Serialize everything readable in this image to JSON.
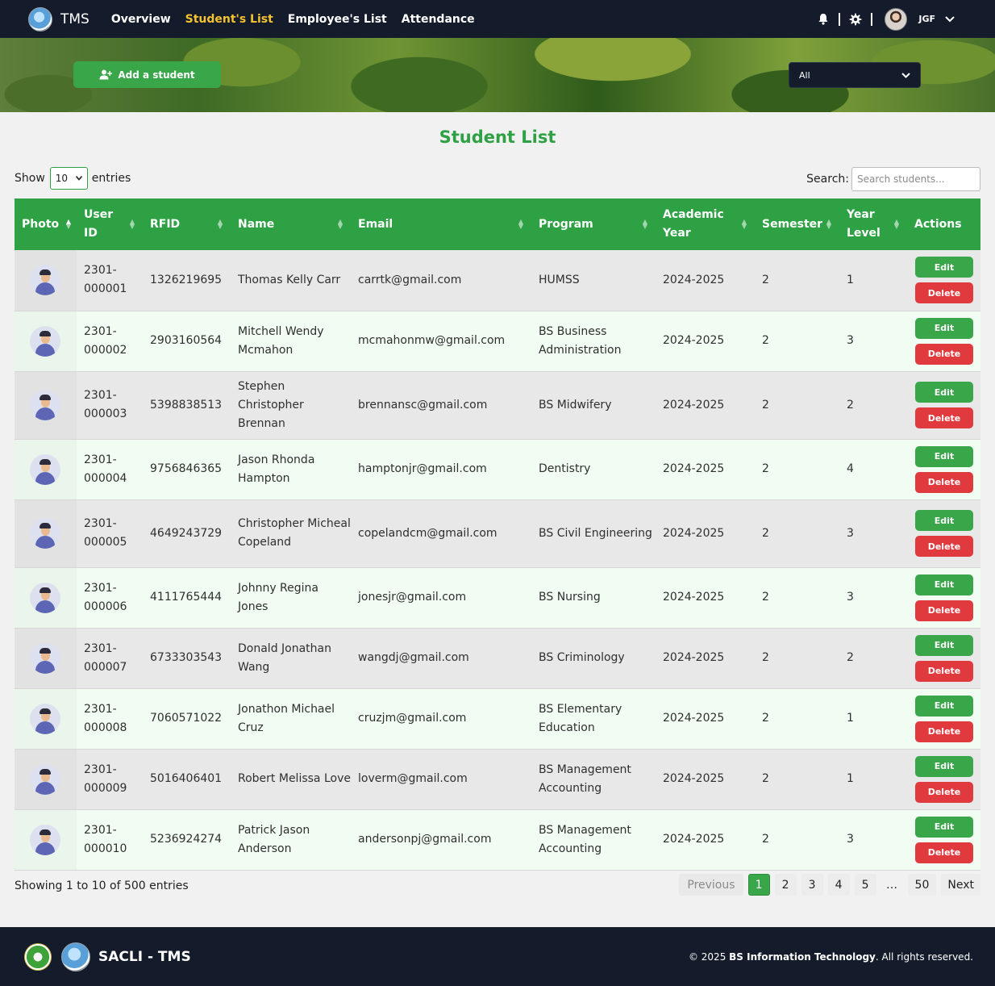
{
  "nav": {
    "brand": "TMS",
    "links": [
      "Overview",
      "Student's List",
      "Employee's List",
      "Attendance"
    ],
    "active_index": 1,
    "user_initials": "JGF"
  },
  "banner": {
    "add_button": "Add a student",
    "filter_value": "All"
  },
  "page_title": "Student List",
  "controls": {
    "show_label": "Show",
    "entries_value": "10",
    "entries_label": "entries",
    "search_label": "Search:",
    "search_placeholder": "Search students..."
  },
  "table": {
    "columns": [
      {
        "label": "Photo"
      },
      {
        "label": "User ID"
      },
      {
        "label": "RFID"
      },
      {
        "label": "Name"
      },
      {
        "label": "Email"
      },
      {
        "label": "Program"
      },
      {
        "label": "Academic Year"
      },
      {
        "label": "Semester"
      },
      {
        "label": "Year Level"
      },
      {
        "label": "Actions"
      }
    ],
    "edit_label": "Edit",
    "delete_label": "Delete",
    "rows": [
      {
        "user_id": "2301-000001",
        "rfid": "1326219695",
        "name": "Thomas Kelly Carr",
        "email": "carrtk@gmail.com",
        "program": "HUMSS",
        "academic_year": "2024-2025",
        "semester": "2",
        "year_level": "1"
      },
      {
        "user_id": "2301-000002",
        "rfid": "2903160564",
        "name": "Mitchell Wendy Mcmahon",
        "email": "mcmahonmw@gmail.com",
        "program": "BS Business Administration",
        "academic_year": "2024-2025",
        "semester": "2",
        "year_level": "3"
      },
      {
        "user_id": "2301-000003",
        "rfid": "5398838513",
        "name": "Stephen Christopher Brennan",
        "email": "brennansc@gmail.com",
        "program": "BS Midwifery",
        "academic_year": "2024-2025",
        "semester": "2",
        "year_level": "2"
      },
      {
        "user_id": "2301-000004",
        "rfid": "9756846365",
        "name": "Jason Rhonda Hampton",
        "email": "hamptonjr@gmail.com",
        "program": "Dentistry",
        "academic_year": "2024-2025",
        "semester": "2",
        "year_level": "4"
      },
      {
        "user_id": "2301-000005",
        "rfid": "4649243729",
        "name": "Christopher Micheal Copeland",
        "email": "copelandcm@gmail.com",
        "program": "BS Civil Engineering",
        "academic_year": "2024-2025",
        "semester": "2",
        "year_level": "3"
      },
      {
        "user_id": "2301-000006",
        "rfid": "4111765444",
        "name": "Johnny Regina Jones",
        "email": "jonesjr@gmail.com",
        "program": "BS Nursing",
        "academic_year": "2024-2025",
        "semester": "2",
        "year_level": "3"
      },
      {
        "user_id": "2301-000007",
        "rfid": "6733303543",
        "name": "Donald Jonathan Wang",
        "email": "wangdj@gmail.com",
        "program": "BS Criminology",
        "academic_year": "2024-2025",
        "semester": "2",
        "year_level": "2"
      },
      {
        "user_id": "2301-000008",
        "rfid": "7060571022",
        "name": "Jonathon Michael Cruz",
        "email": "cruzjm@gmail.com",
        "program": "BS Elementary Education",
        "academic_year": "2024-2025",
        "semester": "2",
        "year_level": "1"
      },
      {
        "user_id": "2301-000009",
        "rfid": "5016406401",
        "name": "Robert Melissa Love",
        "email": "loverm@gmail.com",
        "program": "BS Management Accounting",
        "academic_year": "2024-2025",
        "semester": "2",
        "year_level": "1"
      },
      {
        "user_id": "2301-000010",
        "rfid": "5236924274",
        "name": "Patrick Jason Anderson",
        "email": "andersonpj@gmail.com",
        "program": "BS Management Accounting",
        "academic_year": "2024-2025",
        "semester": "2",
        "year_level": "3"
      }
    ]
  },
  "summary": "Showing 1 to 10 of 500 entries",
  "pagination": {
    "previous": "Previous",
    "pages": [
      "1",
      "2",
      "3",
      "4",
      "5"
    ],
    "ellipsis": "…",
    "last": "50",
    "next": "Next",
    "current": "1"
  },
  "footer": {
    "name": "SACLI - TMS",
    "copyright_prefix": "© 2025",
    "copyright_org": "BS Information Technology",
    "copyright_suffix": ". All rights reserved."
  },
  "colors": {
    "nav_bg": "#141c2c",
    "accent_green": "#2ea144",
    "active_link": "#f5c230",
    "delete_red": "#e0393e"
  }
}
